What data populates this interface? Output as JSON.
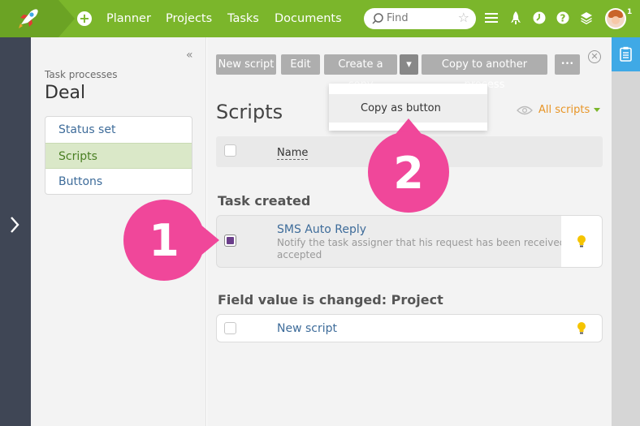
{
  "topbar": {
    "nav": [
      "Planner",
      "Projects",
      "Tasks",
      "Documents"
    ],
    "search_placeholder": "Find",
    "notification_count": "1"
  },
  "sidebar": {
    "section_label": "Task processes",
    "title": "Deal",
    "collapse_glyph": "«",
    "items": [
      {
        "label": "Status set"
      },
      {
        "label": "Scripts"
      },
      {
        "label": "Buttons"
      }
    ]
  },
  "toolbar": {
    "new_script": "New script",
    "edit": "Edit",
    "create_copy": "Create a copy",
    "dropdown_caret": "▾",
    "copy_to_process": "Copy to another process",
    "more": "•••",
    "close": "✕"
  },
  "dropdown": {
    "item": "Copy as button"
  },
  "main": {
    "title": "Scripts",
    "filter": "All scripts",
    "column_name": "Name"
  },
  "groups": [
    {
      "title": "Task created",
      "scripts": [
        {
          "title": "SMS Auto Reply",
          "desc_line1": "Notify the task assigner that his request has been received and",
          "desc_line2": "accepted"
        }
      ]
    },
    {
      "title": "Field value is changed: Project",
      "scripts": [
        {
          "title": "New script"
        }
      ]
    }
  ],
  "annotations": [
    "1",
    "2"
  ],
  "colors": {
    "topbar": "#7bb62b",
    "accent_link": "#3e6c9a",
    "annotation": "#f0479a",
    "filter": "#e89526",
    "right_rail": "#3fa9e6"
  },
  "icons": [
    "rocket-icon",
    "plus-icon",
    "search-icon",
    "star-icon",
    "menu-icon",
    "rocket-small-icon",
    "clock-icon",
    "help-icon",
    "layers-icon",
    "clipboard-icon",
    "chevron-right-icon",
    "eye-icon",
    "bulb-icon"
  ]
}
